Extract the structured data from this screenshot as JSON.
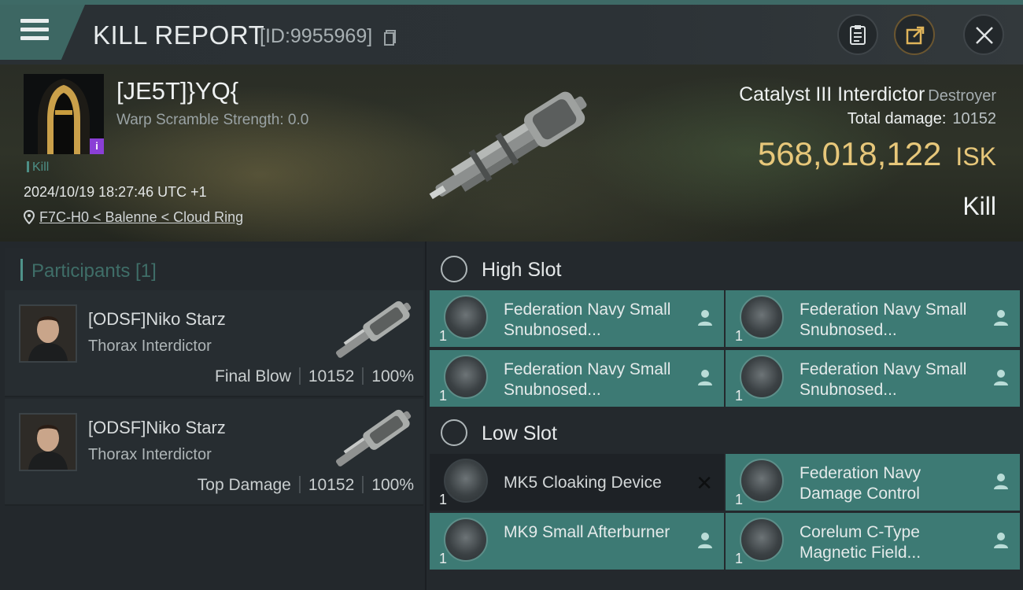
{
  "header": {
    "title": "KILL REPORT",
    "report_id": "[ID:9955969]"
  },
  "victim": {
    "name": "[JE5T]}YQ{",
    "warp_scramble": "Warp Scramble Strength: 0.0",
    "badge": "i",
    "tag": "Kill",
    "datetime": "2024/10/19 18:27:46 UTC +1",
    "location": "F7C-H0 < Balenne < Cloud Ring"
  },
  "ship": {
    "name": "Catalyst III Interdictor",
    "class": "Destroyer",
    "total_damage_label": "Total damage:",
    "total_damage_value": "10152",
    "isk_value": "568,018,122",
    "isk_unit": "ISK",
    "result": "Kill"
  },
  "participants": {
    "label": "Participants [1]",
    "rows": [
      {
        "name": "[ODSF]Niko Starz",
        "ship": "Thorax Interdictor",
        "role": "Final Blow",
        "damage": "10152",
        "percent": "100%"
      },
      {
        "name": "[ODSF]Niko Starz",
        "ship": "Thorax Interdictor",
        "role": "Top Damage",
        "damage": "10152",
        "percent": "100%"
      }
    ]
  },
  "slots": {
    "high": {
      "label": "High Slot",
      "modules": [
        {
          "name": "Federation Navy Small Snubnosed...",
          "qty": "1"
        },
        {
          "name": "Federation Navy Small Snubnosed...",
          "qty": "1"
        },
        {
          "name": "Federation Navy Small Snubnosed...",
          "qty": "1"
        },
        {
          "name": "Federation Navy Small Snubnosed...",
          "qty": "1"
        }
      ]
    },
    "low": {
      "label": "Low Slot",
      "modules": [
        {
          "name": "MK5 Cloaking Device",
          "qty": "1",
          "state": "destroyed"
        },
        {
          "name": "Federation Navy Damage Control",
          "qty": "1",
          "state": "dropped"
        },
        {
          "name": "MK9 Small Afterburner",
          "qty": "1",
          "state": "dropped"
        },
        {
          "name": "Corelum C-Type Magnetic Field...",
          "qty": "1",
          "state": "dropped"
        }
      ]
    }
  },
  "colors": {
    "accent": "#3d7a74",
    "isk": "#e7c77a",
    "badge": "#8a3fd6"
  },
  "icons": [
    "menu-icon",
    "copy-icon",
    "clipboard-icon",
    "share-icon",
    "close-icon",
    "location-pin-icon",
    "person-icon",
    "slot-icon"
  ]
}
